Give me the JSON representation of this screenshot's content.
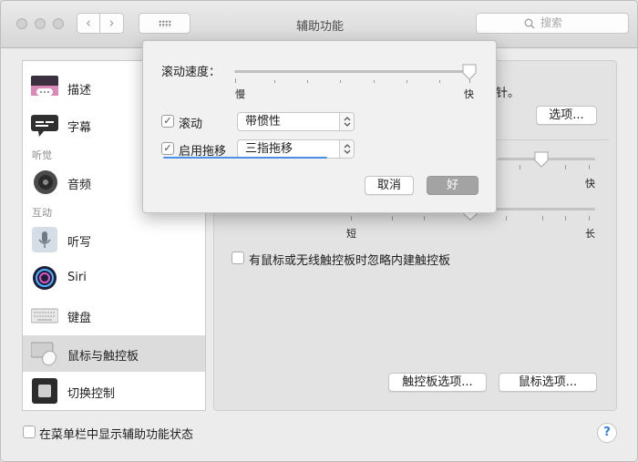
{
  "window": {
    "title": "辅助功能",
    "search_placeholder": "搜索"
  },
  "sidebar": {
    "items": [
      {
        "label": "描述",
        "icon": "description-icon"
      },
      {
        "label": "字幕",
        "icon": "captions-icon"
      },
      {
        "label": "音频",
        "icon": "speaker-icon"
      },
      {
        "label": "听写",
        "icon": "microphone-icon"
      },
      {
        "label": "Siri",
        "icon": "siri-icon"
      },
      {
        "label": "键盘",
        "icon": "keyboard-icon"
      },
      {
        "label": "鼠标与触控板",
        "icon": "mouse-trackpad-icon",
        "selected": true
      },
      {
        "label": "切换控制",
        "icon": "switch-control-icon"
      }
    ],
    "headings": {
      "hearing": "听觉",
      "interacting": "互动"
    }
  },
  "main": {
    "partial_text": "针。",
    "options_button": "选项...",
    "slider_fast_label": "快",
    "slider_short_label": "短",
    "slider_long_label": "长",
    "ignore_trackpad_label": "有鼠标或无线触控板时忽略内建触控板",
    "trackpad_options_button": "触控板选项...",
    "mouse_options_button": "鼠标选项..."
  },
  "popover": {
    "scroll_speed_label": "滚动速度：",
    "slow_label": "慢",
    "fast_label": "快",
    "scroll_speed_value": 1.0,
    "scrolling_label": "滚动",
    "scrolling_checked": true,
    "scrolling_value": "带惯性",
    "dragging_label": "启用拖移",
    "dragging_checked": true,
    "dragging_value": "三指拖移",
    "cancel_button": "取消",
    "ok_button": "好"
  },
  "footer": {
    "show_status_label": "在菜单栏中显示辅助功能状态",
    "show_status_checked": false,
    "help_label": "?"
  },
  "colors": {
    "accent": "#2f7ee6",
    "selected_row": "#dcdcdc"
  }
}
